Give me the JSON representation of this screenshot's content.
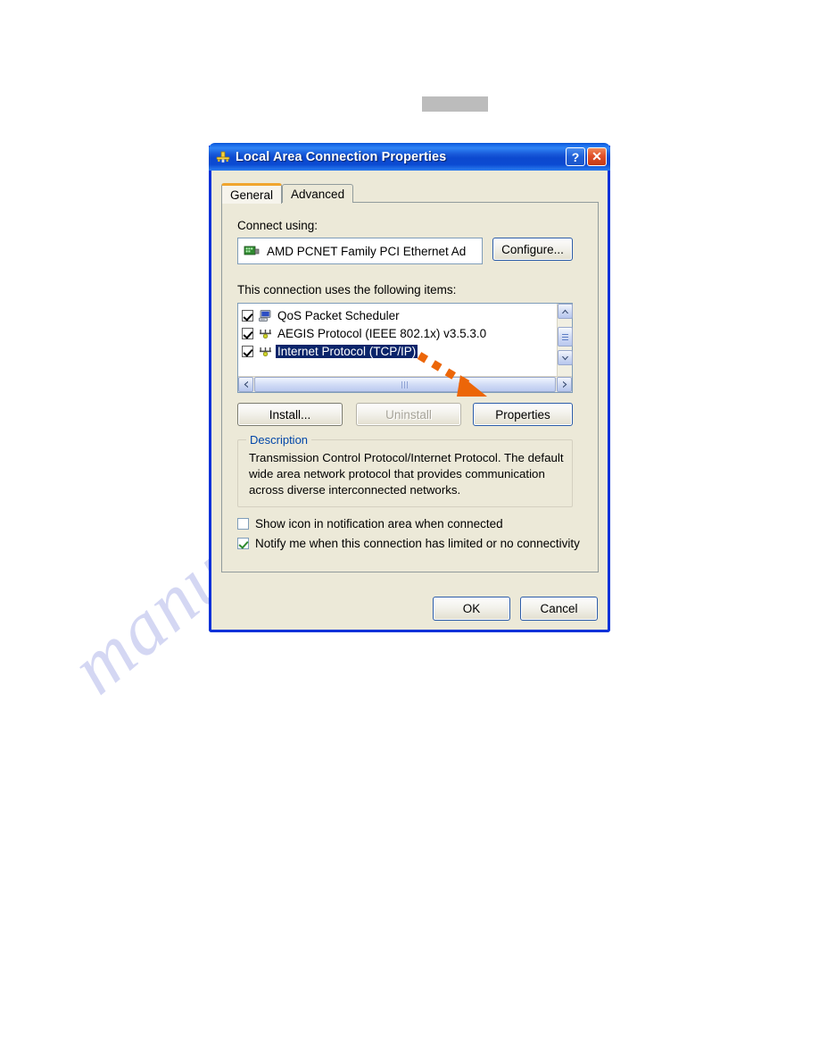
{
  "page": {
    "redacted_header": ""
  },
  "watermark": {
    "text": "manualshive.com"
  },
  "dialog": {
    "title": "Local Area Connection Properties",
    "title_icon": "network-connection-icon",
    "titlebar_buttons": [
      {
        "name": "help-button",
        "glyph": "?"
      },
      {
        "name": "close-button",
        "glyph": "✕"
      }
    ],
    "tabs": [
      {
        "label": "General",
        "active": true
      },
      {
        "label": "Advanced",
        "active": false
      }
    ],
    "connect_using": {
      "label": "Connect using:",
      "adapter_name": "AMD PCNET Family PCI Ethernet Ad",
      "adapter_icon": "network-adapter-icon",
      "configure_button": "Configure..."
    },
    "items_section": {
      "label": "This connection uses the following items:",
      "items": [
        {
          "label": "QoS Packet Scheduler",
          "checked": true,
          "selected": false,
          "icon": "computer-service-icon"
        },
        {
          "label": "AEGIS Protocol (IEEE 802.1x) v3.5.3.0",
          "checked": true,
          "selected": false,
          "icon": "network-protocol-icon"
        },
        {
          "label": "Internet Protocol (TCP/IP)",
          "checked": true,
          "selected": true,
          "icon": "network-protocol-icon"
        }
      ]
    },
    "action_buttons": {
      "install": "Install...",
      "uninstall": "Uninstall",
      "uninstall_disabled": true,
      "properties": "Properties"
    },
    "description": {
      "title": "Description",
      "text": "Transmission Control Protocol/Internet Protocol. The default wide area network protocol that provides communication across diverse interconnected networks."
    },
    "options": [
      {
        "label": "Show icon in notification area when connected",
        "checked": false
      },
      {
        "label": "Notify me when this connection has limited or no connectivity",
        "checked": true
      }
    ],
    "footer_buttons": {
      "ok": "OK",
      "cancel": "Cancel"
    }
  },
  "annotation": {
    "type": "dashed-arrow",
    "points_to": "properties-button",
    "color": "#ec6608"
  },
  "colors": {
    "titlebar_blue": "#0831d9",
    "dialog_face": "#ece9d8",
    "selection_blue": "#0a246a",
    "accent_orange": "#f0a52e",
    "annotation_orange": "#ec6608",
    "group_title_blue": "#0046a8",
    "watermark": "#c9cdf0",
    "redacted_gray": "#bcbcbc"
  }
}
